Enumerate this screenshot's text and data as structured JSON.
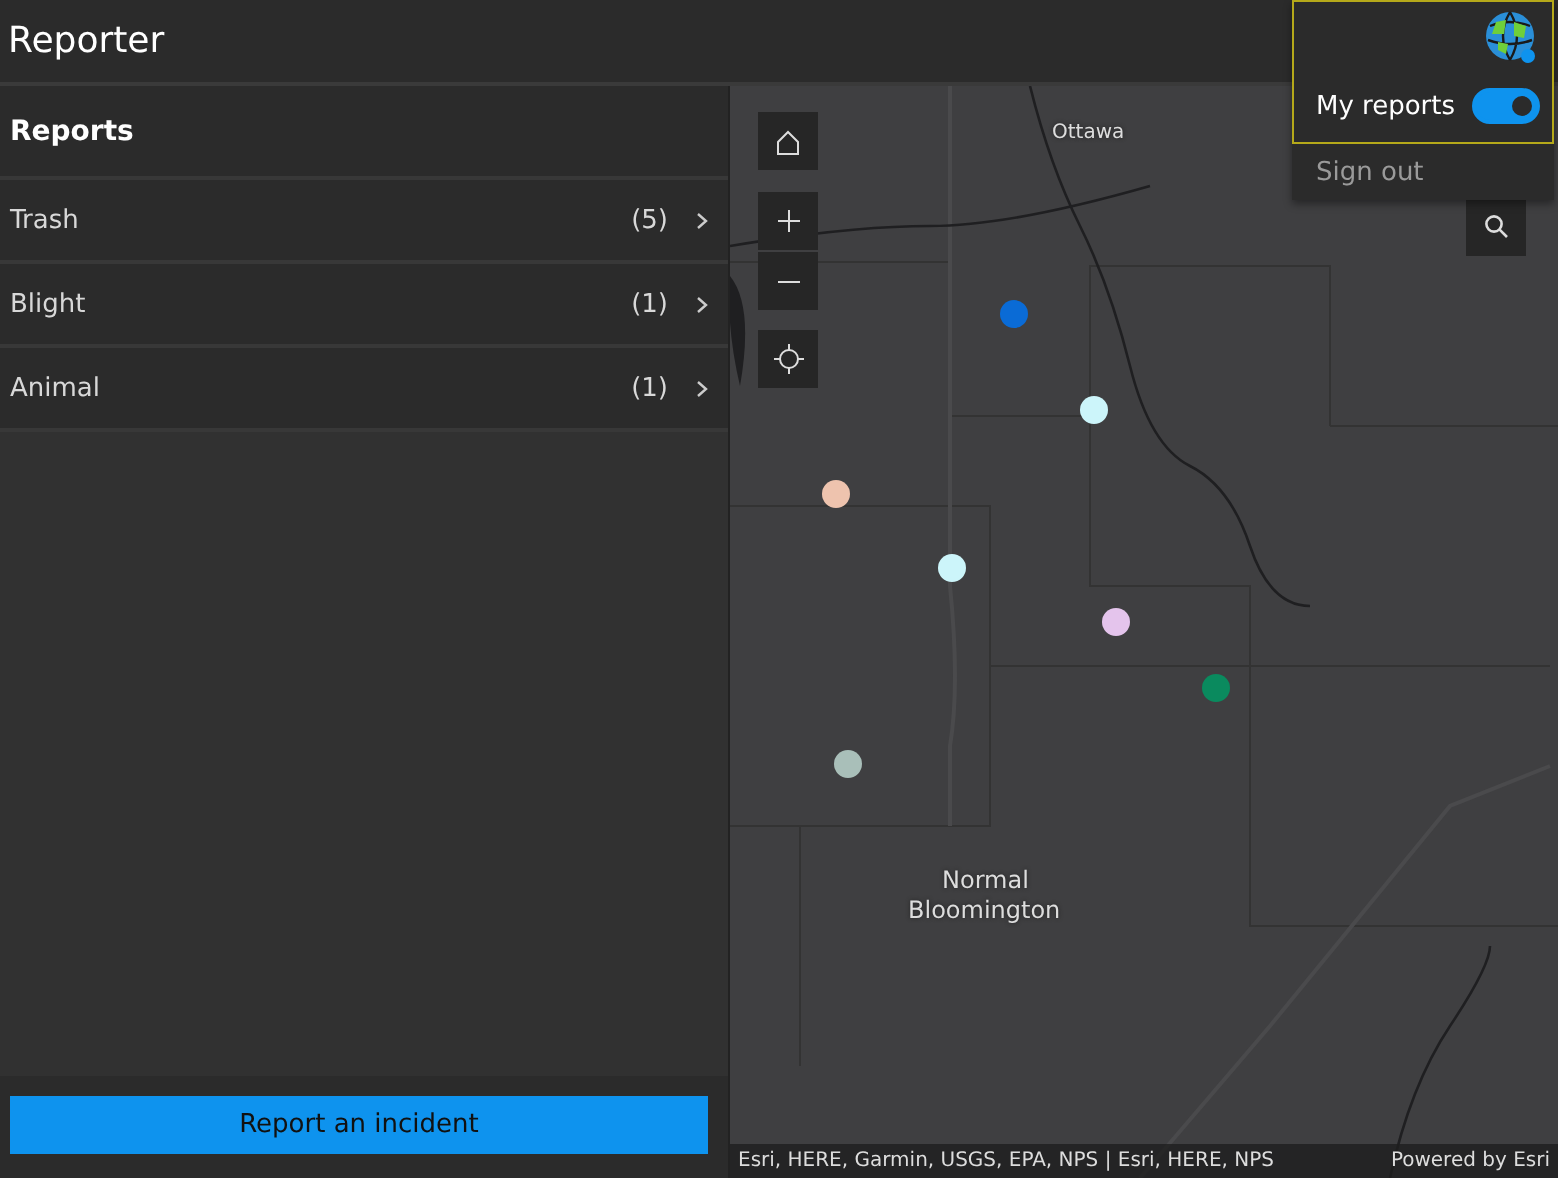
{
  "app": {
    "title": "Reporter"
  },
  "panel": {
    "title": "Reports",
    "categories": [
      {
        "label": "Trash",
        "count": "(5)"
      },
      {
        "label": "Blight",
        "count": "(1)"
      },
      {
        "label": "Animal",
        "count": "(1)"
      }
    ],
    "action": "Report an incident"
  },
  "map": {
    "labels": [
      {
        "kind": "small",
        "text": "Ottawa"
      },
      {
        "kind": "city",
        "text": "Normal"
      },
      {
        "kind": "city",
        "text": "Bloomington"
      }
    ],
    "markers": [
      {
        "color": "#0a6bd6"
      },
      {
        "color": "#ccf5fa"
      },
      {
        "color": "#eec3ae"
      },
      {
        "color": "#ccf5fa"
      },
      {
        "color": "#e4c4ec"
      },
      {
        "color": "#0a8a5e"
      },
      {
        "color": "#a9bfb9"
      }
    ],
    "attribution": "Esri, HERE, Garmin, USGS, EPA, NPS | Esri, HERE, NPS",
    "powered_by": "Powered by Esri"
  },
  "user_menu": {
    "toggle": {
      "label": "My reports",
      "on": true
    },
    "sign_out": "Sign out"
  }
}
